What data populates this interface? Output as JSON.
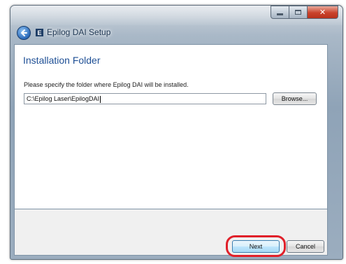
{
  "window": {
    "title": "Epilog DAI Setup",
    "app_icon_letter": "E",
    "caption_buttons": [
      "minimize",
      "maximize",
      "close"
    ],
    "close_glyph": "✕"
  },
  "page": {
    "heading": "Installation Folder",
    "instruction": "Please specify the folder where Epilog DAI will be installed.",
    "install_path": "C:\\Epilog Laser\\EpilogDAI",
    "browse_label": "Browse..."
  },
  "footer": {
    "next_label": "Next",
    "cancel_label": "Cancel",
    "highlight": "next-button"
  },
  "colors": {
    "heading": "#1e4f95",
    "highlight_ring": "#e0202a",
    "window_frame": "#9badbf"
  },
  "icons": [
    "back-arrow-icon",
    "app-icon",
    "minimize-icon",
    "maximize-icon",
    "close-icon"
  ]
}
